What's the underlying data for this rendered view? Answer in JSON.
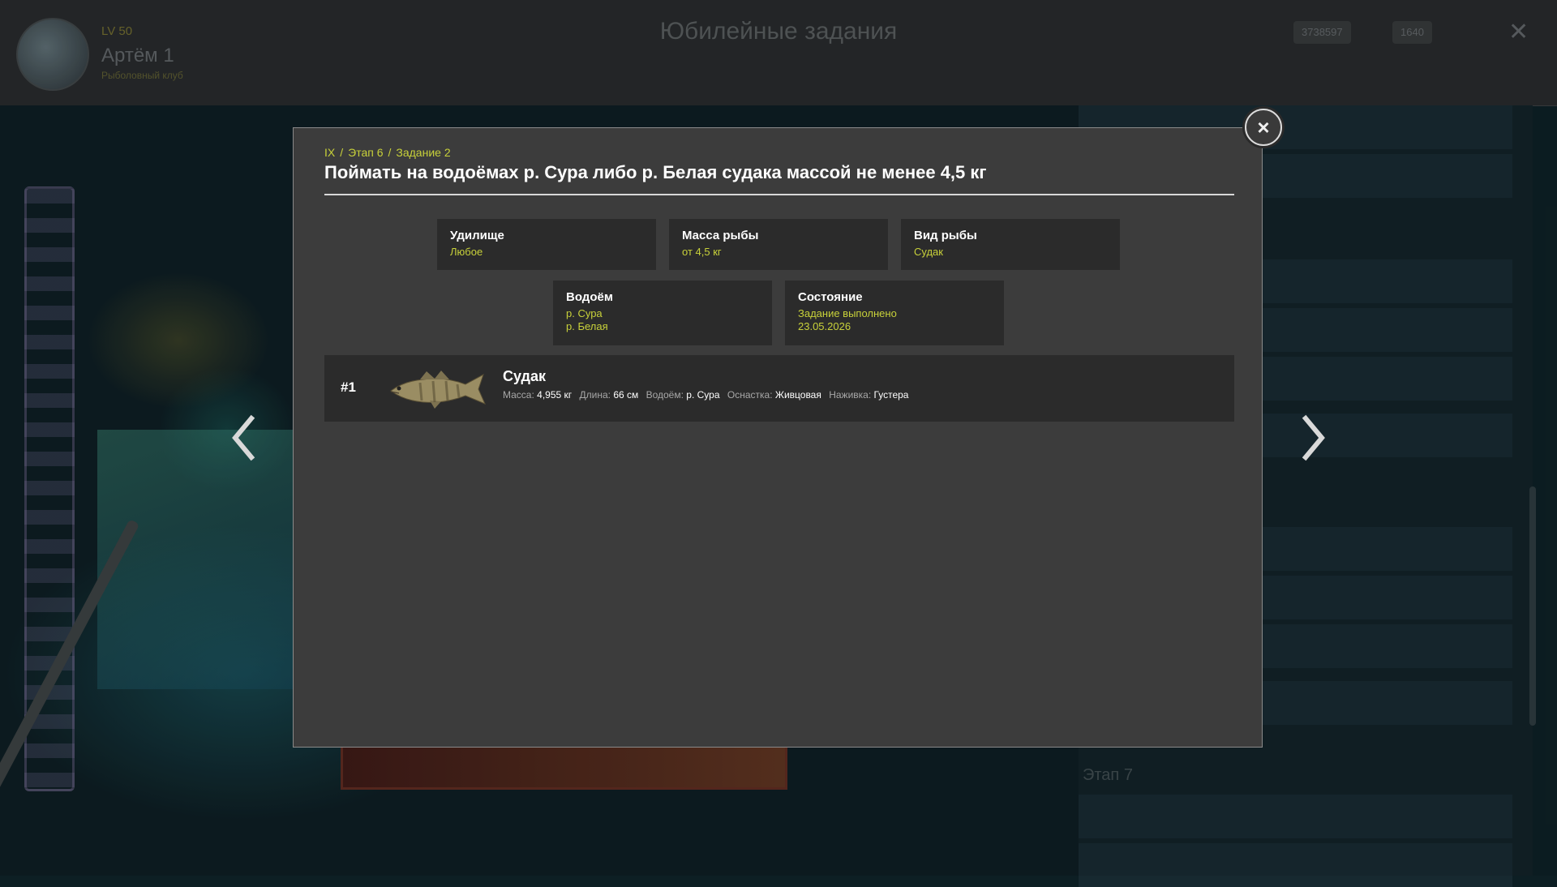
{
  "background": {
    "header_title": "Юбилейные задания",
    "player_level": "LV 50",
    "player_name": "Артём 1",
    "player_subtitle": "Рыболовный клуб",
    "currency_silver": "3738597",
    "currency_gold": "1640",
    "right_stage_label": "Этап 7"
  },
  "modal": {
    "breadcrumb": {
      "level": "IX",
      "stage": "Этап 6",
      "task": "Задание 2",
      "separator": "/"
    },
    "title": "Поймать на водоёмах р. Сура либо р. Белая судака массой не менее 4,5 кг",
    "close_icon": "×",
    "conditions": [
      {
        "label": "Удилище",
        "values": [
          "Любое"
        ]
      },
      {
        "label": "Масса рыбы",
        "values": [
          "от 4,5 кг"
        ]
      },
      {
        "label": "Вид рыбы",
        "values": [
          "Судак"
        ]
      },
      {
        "label": "Водоём",
        "values": [
          "р. Сура",
          "р. Белая"
        ]
      },
      {
        "label": "Состояние",
        "values": [
          "Задание выполнено",
          "23.05.2026"
        ]
      }
    ],
    "catch": {
      "number": "#1",
      "fish_name": "Судак",
      "mass_label": "Масса:",
      "mass_value": "4,955 кг",
      "length_label": "Длина:",
      "length_value": "66 см",
      "water_label": "Водоём:",
      "water_value": "р. Сура",
      "tackle_label": "Оснастка:",
      "tackle_value": "Живцовая",
      "bait_label": "Наживка:",
      "bait_value": "Густера"
    }
  },
  "icons": {
    "prev": "chevron-left-icon",
    "next": "chevron-right-icon",
    "close": "close-icon",
    "fish": "zander-fish-icon"
  },
  "colors": {
    "accent_yellow": "#c8d13a",
    "modal_bg": "#3c3c3c",
    "card_bg": "#2b2b2b"
  }
}
